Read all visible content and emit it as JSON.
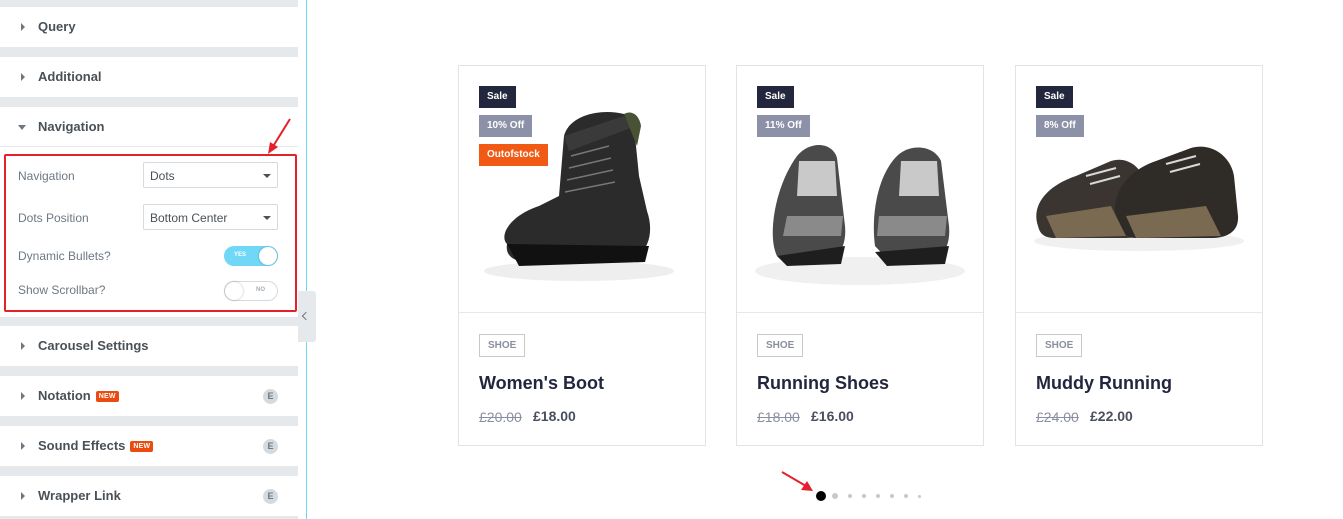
{
  "panel": {
    "sections_top": [
      {
        "title": "Query"
      },
      {
        "title": "Additional"
      },
      {
        "title": "Navigation"
      }
    ],
    "navigation_controls": {
      "navigation": {
        "label": "Navigation",
        "value": "Dots"
      },
      "dots_position": {
        "label": "Dots Position",
        "value": "Bottom Center"
      },
      "dynamic_bullets": {
        "label": "Dynamic Bullets?",
        "state": "YES"
      },
      "show_scrollbar": {
        "label": "Show Scrollbar?",
        "state": "NO"
      }
    },
    "sections_bottom": [
      {
        "title": "Carousel Settings"
      },
      {
        "title": "Notation",
        "badge": "NEW"
      },
      {
        "title": "Sound Effects",
        "badge": "NEW"
      },
      {
        "title": "Wrapper Link"
      }
    ],
    "pro_icon_glyph": "E",
    "highlight_color": "#e5202a",
    "toggle_on_color": "#71d7f7"
  },
  "products": [
    {
      "tags": [
        "Sale",
        "10% Off",
        "Outofstock"
      ],
      "category": "SHOE",
      "name": "Women's Boot",
      "old_price": "£20.00",
      "price": "£18.00"
    },
    {
      "tags": [
        "Sale",
        "11% Off"
      ],
      "category": "SHOE",
      "name": "Running Shoes",
      "old_price": "£18.00",
      "price": "£16.00"
    },
    {
      "tags": [
        "Sale",
        "8% Off"
      ],
      "category": "SHOE",
      "name": "Muddy Running",
      "old_price": "£24.00",
      "price": "£22.00"
    }
  ],
  "carousel": {
    "dot_count": 8,
    "active_index": 0
  },
  "colors": {
    "sale_tag": "#23273d",
    "discount_tag": "#8c91a8",
    "out_of_stock_tag": "#f05a14",
    "annotation_arrow": "#e5202a"
  }
}
